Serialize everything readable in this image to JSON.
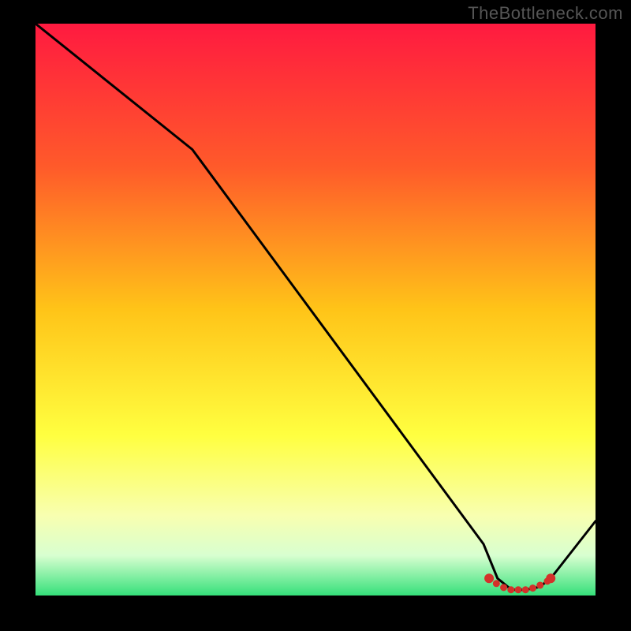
{
  "watermark": "TheBottleneck.com",
  "chart_data": {
    "type": "line",
    "title": "",
    "xlabel": "",
    "ylabel": "",
    "xlim": [
      0,
      100
    ],
    "ylim": [
      0,
      100
    ],
    "gradient_stops": [
      {
        "offset": 0,
        "color": "#ff1a40"
      },
      {
        "offset": 25,
        "color": "#ff5a2a"
      },
      {
        "offset": 50,
        "color": "#ffc418"
      },
      {
        "offset": 72,
        "color": "#ffff40"
      },
      {
        "offset": 86,
        "color": "#f8ffb0"
      },
      {
        "offset": 93,
        "color": "#d8ffd0"
      },
      {
        "offset": 100,
        "color": "#35e07a"
      }
    ],
    "series": [
      {
        "name": "bottleneck-curve",
        "type": "line",
        "color": "#000000",
        "x": [
          0,
          28,
          80,
          82.5,
          85,
          87.5,
          90,
          92,
          100
        ],
        "values": [
          100,
          78,
          9,
          3,
          1,
          1,
          1.5,
          3,
          13
        ]
      },
      {
        "name": "optimal-range",
        "type": "scatter",
        "color": "#d4312a",
        "x": [
          81,
          82.3,
          83.6,
          84.9,
          86.2,
          87.5,
          88.8,
          90.1,
          91.4,
          92
        ],
        "values": [
          3,
          2.1,
          1.4,
          1.0,
          1.0,
          1.0,
          1.3,
          1.8,
          2.5,
          3
        ]
      }
    ]
  }
}
